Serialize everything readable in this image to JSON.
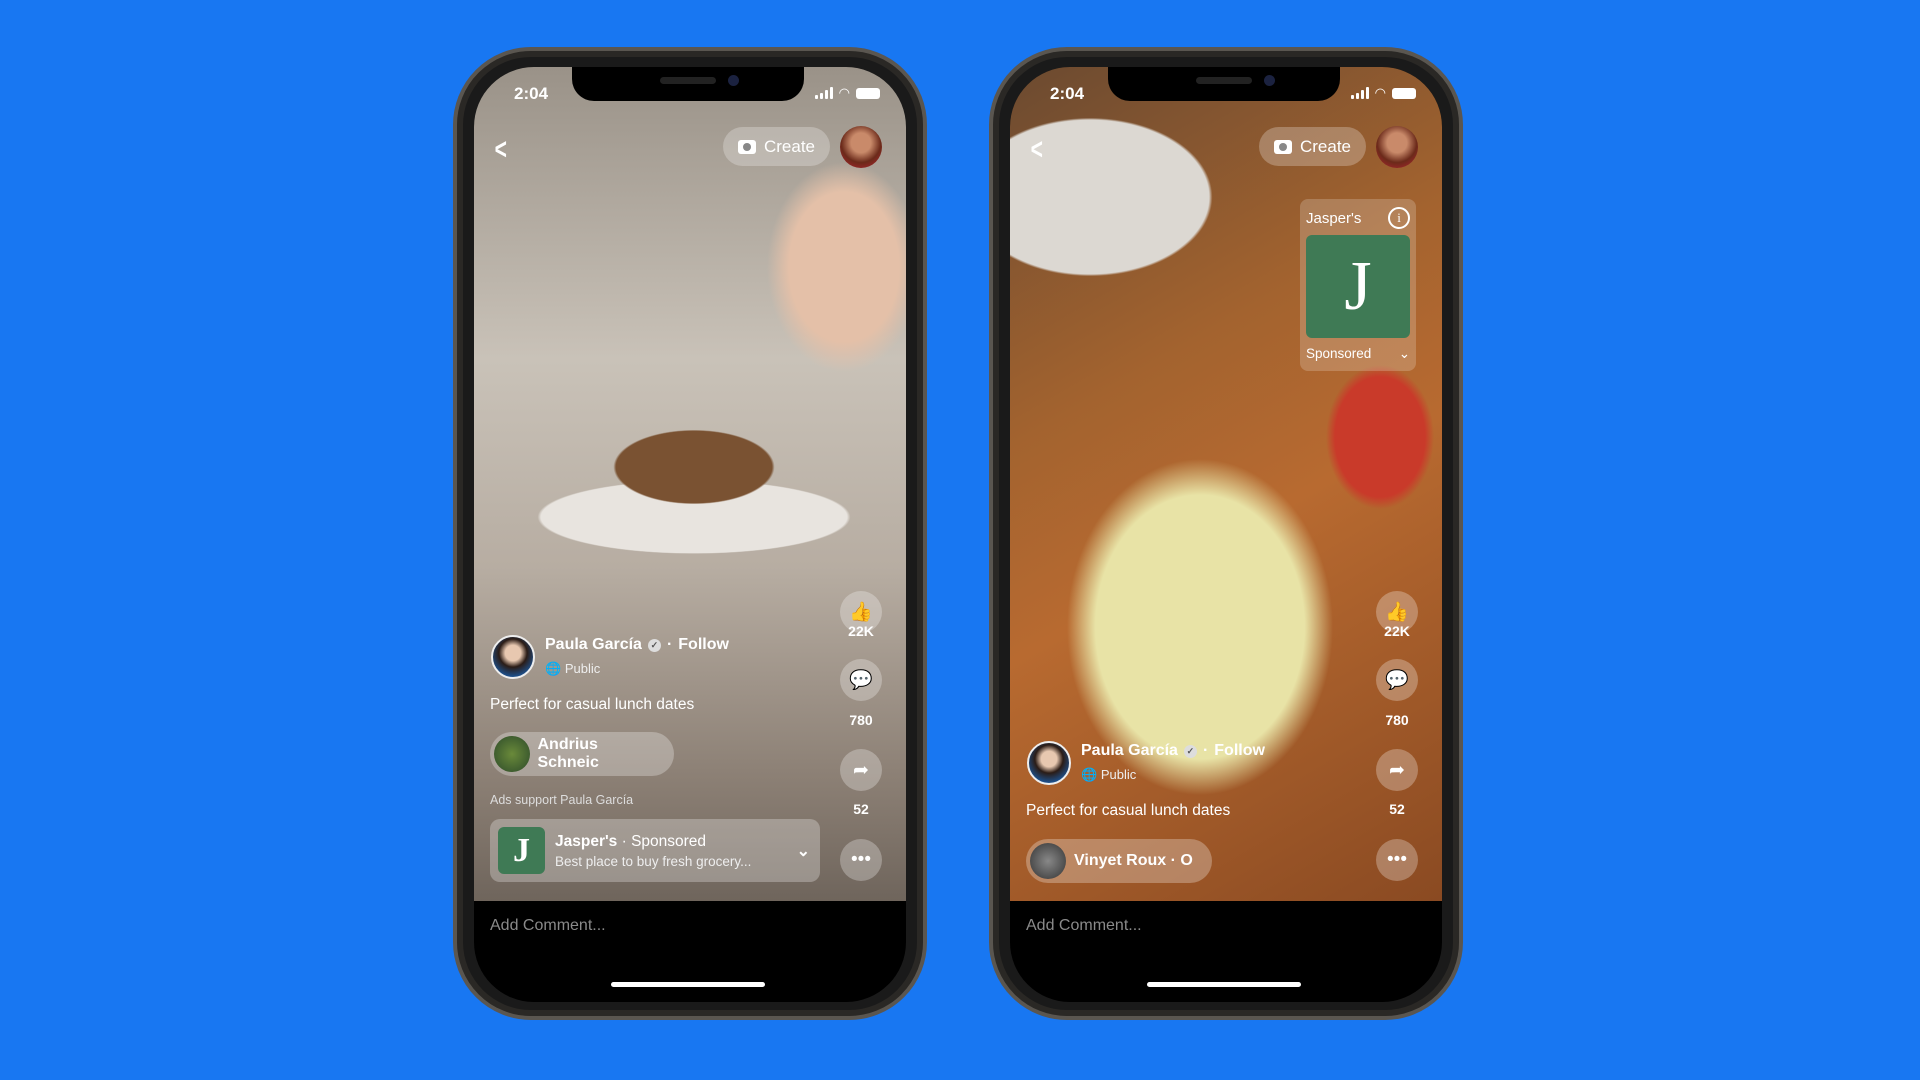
{
  "phones": [
    {
      "status": {
        "time": "2:04"
      },
      "header": {
        "create_label": "Create"
      },
      "actions": {
        "likes": "22K",
        "comments": "780",
        "shares": "52"
      },
      "post": {
        "author": "Paula García",
        "follow": "Follow",
        "separator": "·",
        "audience": "Public",
        "caption": "Perfect for casual lunch dates",
        "music": "Andrius Schneic"
      },
      "ad": {
        "support_text": "Ads support Paula García",
        "brand": "Jasper's",
        "sponsored": " · Sponsored",
        "description": "Best place to buy fresh grocery...",
        "logo_letter": "J"
      },
      "comment_placeholder": "Add Comment..."
    },
    {
      "status": {
        "time": "2:04"
      },
      "header": {
        "create_label": "Create"
      },
      "actions": {
        "likes": "22K",
        "comments": "780",
        "shares": "52"
      },
      "post": {
        "author": "Paula García",
        "follow": "Follow",
        "separator": "·",
        "audience": "Public",
        "caption": "Perfect for casual lunch dates",
        "music": "Vinyet Roux · O"
      },
      "ad": {
        "brand": "Jasper's",
        "sponsored": "Sponsored",
        "logo_letter": "J"
      },
      "comment_placeholder": "Add Comment..."
    }
  ],
  "colors": {
    "background": "#1877f2",
    "ad_green": "#3f7a55"
  }
}
